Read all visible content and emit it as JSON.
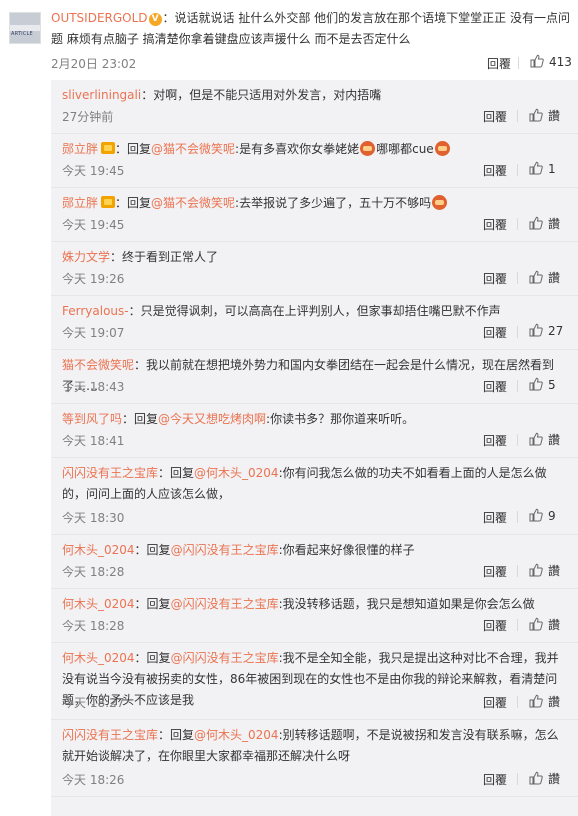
{
  "post": {
    "avatar_text": "ARTICLE",
    "author": "OUTSIDERGOLD",
    "verified_badge": "V",
    "text_before_author": "",
    "text": "：说话就说话 扯什么外交部 他们的发言放在那个语境下堂堂正正 没有一点问题 麻烦有点脑子 搞清楚你拿着键盘应该声援什么 而不是去否定什么",
    "time": "2月20日 23:02",
    "reply_label": "回覆",
    "like_count": "413"
  },
  "replies": [
    {
      "user": "sliverliningali",
      "reply_prefix": "",
      "mention": "",
      "content": "：对啊，但是不能只适用对外发言，对内捂嘴",
      "time": "27分钟前",
      "reply_label": "回覆",
      "like_label": "讚",
      "vip": false,
      "emoji_after": 0
    },
    {
      "user": "郧立胖",
      "reply_prefix": "：回复",
      "mention": "@猫不会微笑呢",
      "content": ":是有多喜欢你女拳姥姥",
      "tail": "哪哪都cue",
      "time": "今天 19:45",
      "reply_label": "回覆",
      "like_label": "1",
      "vip": true,
      "emoji_after": 1
    },
    {
      "user": "郧立胖",
      "reply_prefix": "：回复",
      "mention": "@猫不会微笑呢",
      "content": ":去举报说了多少遍了，五十万不够吗",
      "time": "今天 19:45",
      "reply_label": "回覆",
      "like_label": "讚",
      "vip": true,
      "emoji_after": 1
    },
    {
      "user": "姝力文学",
      "reply_prefix": "",
      "mention": "",
      "content": "：终于看到正常人了",
      "time": "今天 19:26",
      "reply_label": "回覆",
      "like_label": "讚",
      "vip": false,
      "emoji_after": 0
    },
    {
      "user": "Ferryalous-",
      "reply_prefix": "",
      "mention": "",
      "content": "：只是觉得讽刺，可以高高在上评判别人，但家事却捂住嘴巴默不作声",
      "time": "今天 19:07",
      "reply_label": "回覆",
      "like_label": "27",
      "vip": false,
      "emoji_after": 0
    },
    {
      "user": "猫不会微笑呢",
      "reply_prefix": "",
      "mention": "",
      "content": "：我以前就在想把境外势力和国内女拳团结在一起会是什么情况，现在居然看到了……",
      "time": "今天 18:43",
      "reply_label": "回覆",
      "like_label": "5",
      "vip": false,
      "emoji_after": 0
    },
    {
      "user": "等到风了吗",
      "reply_prefix": "：回复",
      "mention": "@今天又想吃烤肉啊",
      "content": ":你读书多？那你道来听听。",
      "time": "今天 18:41",
      "reply_label": "回覆",
      "like_label": "讚",
      "vip": false,
      "emoji_after": 0
    },
    {
      "user": "闪闪没有王之宝库",
      "reply_prefix": "：回复",
      "mention": "@何木头_0204",
      "content": ":你有问我怎么做的功夫不如看看上面的人是怎么做的，问问上面的人应该怎么做，",
      "time": "今天 18:30",
      "reply_label": "回覆",
      "like_label": "9",
      "vip": false,
      "emoji_after": 0
    },
    {
      "user": "何木头_0204",
      "reply_prefix": "：回复",
      "mention": "@闪闪没有王之宝库",
      "content": ":你看起来好像很懂的样子",
      "time": "今天 18:28",
      "reply_label": "回覆",
      "like_label": "讚",
      "vip": false,
      "emoji_after": 0
    },
    {
      "user": "何木头_0204",
      "reply_prefix": "：回复",
      "mention": "@闪闪没有王之宝库",
      "content": ":我没转移话题，我只是想知道如果是你会怎么做",
      "time": "今天 18:28",
      "reply_label": "回覆",
      "like_label": "讚",
      "vip": false,
      "emoji_after": 0
    },
    {
      "user": "何木头_0204",
      "reply_prefix": "：回复",
      "mention": "@闪闪没有王之宝库",
      "content": ":我不是全知全能，我只是提出这种对比不合理，我并没有说当今没有被拐卖的女性，86年被困到现在的女性也不是由你我的辩论来解救，看清楚问题，你的矛头不应该是我",
      "time": "今天 18:27",
      "reply_label": "回覆",
      "like_label": "讚",
      "vip": false,
      "emoji_after": 0
    },
    {
      "user": "闪闪没有王之宝库",
      "reply_prefix": "：回复",
      "mention": "@何木头_0204",
      "content": ":别转移话题啊，不是说被拐和发言没有联系嘛，怎么就开始谈解决了，在你眼里大家都幸福那还解决什么呀",
      "time": "今天 18:26",
      "reply_label": "回覆",
      "like_label": "讚",
      "vip": false,
      "emoji_after": 0
    }
  ]
}
